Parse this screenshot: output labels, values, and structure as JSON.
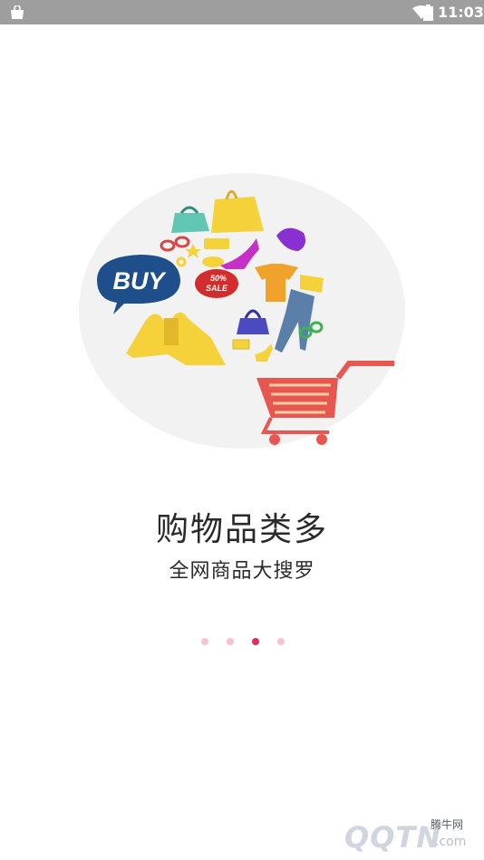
{
  "status_bar": {
    "time": "11:03",
    "icons": [
      "shopping-bag-icon",
      "wifi-icon",
      "battery-icon"
    ]
  },
  "illustration": {
    "buy_bubble": "BUY",
    "sale_percent": "50%",
    "sale_label": "SALE"
  },
  "onboarding": {
    "title": "购物品类多",
    "subtitle": "全网商品大搜罗",
    "page_indicator": {
      "count": 4,
      "active_index": 2
    }
  },
  "watermark": {
    "logo_text": "QQTN",
    "domain_suffix": ".com",
    "chinese_name": "腾牛网"
  },
  "colors": {
    "accent": "#e22e54",
    "dot_inactive": "#f7c3cf",
    "status_bar": "#9e9e9e",
    "circle_bg": "#f2f2f2",
    "cart_red": "#e8574f",
    "bubble_blue": "#1f4f8a"
  }
}
